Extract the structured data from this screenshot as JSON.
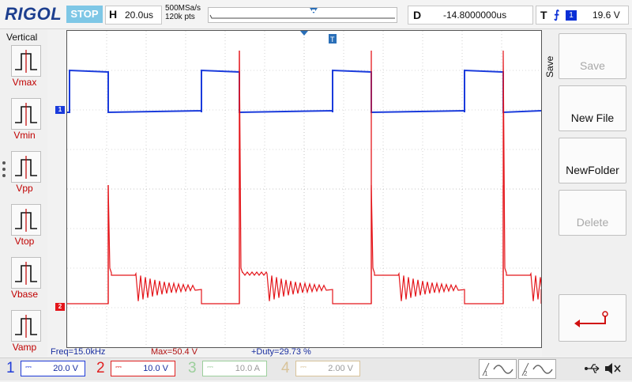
{
  "brand": "RIGOL",
  "run_status": "STOP",
  "horizontal": {
    "label": "H",
    "timebase": "20.0us"
  },
  "acquisition": {
    "sample_rate": "500MSa/s",
    "memory_depth": "120k pts"
  },
  "delay": {
    "label": "D",
    "value": "-14.8000000us"
  },
  "trigger": {
    "label": "T",
    "edge_symbol": "⨍",
    "source": "1",
    "level": "19.6 V"
  },
  "vertical_menu": {
    "title": "Vertical",
    "items": [
      {
        "label": "Vmax"
      },
      {
        "label": "Vmin"
      },
      {
        "label": "Vpp"
      },
      {
        "label": "Vtop"
      },
      {
        "label": "Vbase"
      },
      {
        "label": "Vamp"
      }
    ]
  },
  "right_menu": {
    "title": "Save",
    "buttons": [
      {
        "label": "Save",
        "enabled": false
      },
      {
        "label": "New File",
        "enabled": true
      },
      {
        "label": "NewFolder",
        "enabled": true
      },
      {
        "label": "Delete",
        "enabled": false
      }
    ],
    "back_icon": "return-arrow-icon"
  },
  "measurements": {
    "freq": "Freq=15.0kHz",
    "max": "Max=50.4 V",
    "duty": "+Duty=29.73 %"
  },
  "channels": [
    {
      "number": "1",
      "scale": "20.0 V",
      "coupling": "DC",
      "color": "#1f3bd8",
      "active": true
    },
    {
      "number": "2",
      "scale": "10.0 V",
      "coupling": "DC",
      "color": "#e02020",
      "active": true
    },
    {
      "number": "3",
      "scale": "10.0 A",
      "coupling": "DC",
      "color": "#9ccf9c",
      "active": false
    },
    {
      "number": "4",
      "scale": "2.00 V",
      "coupling": "DC",
      "color": "#d8c39a",
      "active": false
    }
  ],
  "colors": {
    "ch1": "#1a3bdc",
    "ch2": "#e4161b",
    "accent": "#7ec7e6",
    "grid": "#b4b4b4"
  },
  "icons": [
    "usb-icon",
    "speaker-mute-icon",
    "math-wave-icon"
  ]
}
